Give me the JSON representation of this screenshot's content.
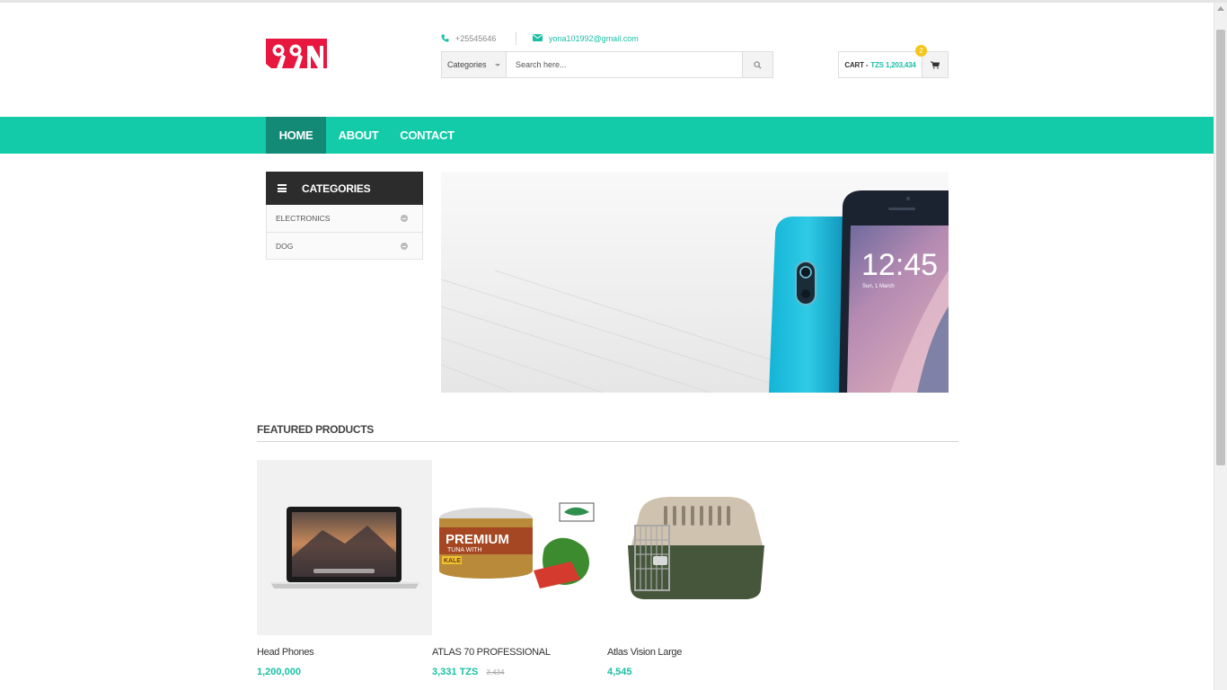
{
  "header": {
    "logo_text": "99N",
    "phone": "+25545646",
    "email": "yona101992@gmail.com"
  },
  "search": {
    "category_label": "Categories",
    "placeholder": "Search here..."
  },
  "cart": {
    "label": "CART -",
    "total": "TZS 1,203,434",
    "count": "2"
  },
  "nav": {
    "items": [
      {
        "label": "HOME"
      },
      {
        "label": "ABOUT"
      },
      {
        "label": "CONTACT"
      }
    ]
  },
  "sidebar": {
    "title": "CATEGORIES",
    "items": [
      {
        "label": "ELECTRONICS"
      },
      {
        "label": "DOG"
      }
    ]
  },
  "banner": {
    "time": "12:45",
    "date": "Sun, 1 March"
  },
  "featured": {
    "title": "FEATURED PRODUCTS",
    "products": [
      {
        "name": "Head Phones",
        "price": "1,200,000",
        "old_price": ""
      },
      {
        "name": "ATLAS 70 PROFESSIONAL",
        "price": "3,331 TZS",
        "old_price": "3,434"
      },
      {
        "name": "Atlas Vision Large",
        "price": "4,545",
        "old_price": ""
      }
    ]
  },
  "colors": {
    "accent": "#13cba9",
    "nav_active": "#138a76",
    "dark": "#2c2c2c",
    "badge": "#f5c518",
    "logo_red": "#e8173f"
  },
  "icons": [
    "phone-icon",
    "envelope-icon",
    "search-icon",
    "cart-icon",
    "menu-icon",
    "plus-circle-icon"
  ]
}
